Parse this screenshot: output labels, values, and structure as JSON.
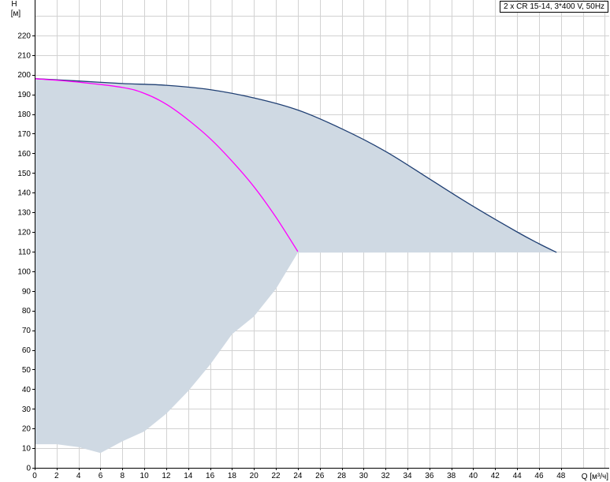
{
  "chart_data": {
    "type": "line",
    "title": "",
    "legend": "2 x CR 15-14, 3*400 V, 50Hz",
    "legend_placement": "top-right",
    "xlabel": "Q [м³/ч]",
    "ylabel": "H",
    "ylabel_unit": "[м]",
    "xlim": [
      0,
      52.4
    ],
    "ylim": [
      0,
      238
    ],
    "grid": true,
    "x_ticks": [
      0,
      2,
      4,
      6,
      8,
      10,
      12,
      14,
      16,
      18,
      20,
      22,
      24,
      26,
      28,
      30,
      32,
      34,
      36,
      38,
      40,
      42,
      44,
      46,
      48
    ],
    "y_ticks": [
      0,
      10,
      20,
      30,
      40,
      50,
      60,
      70,
      80,
      90,
      100,
      110,
      120,
      130,
      140,
      150,
      160,
      170,
      180,
      190,
      200,
      210,
      220
    ],
    "series": [
      {
        "id": "two-pumps",
        "color": "#1f3f73",
        "points": [
          [
            0,
            198
          ],
          [
            4,
            196.8
          ],
          [
            8,
            195.5
          ],
          [
            12,
            194.6
          ],
          [
            16,
            192.4
          ],
          [
            20,
            188.2
          ],
          [
            24,
            182
          ],
          [
            28,
            172.5
          ],
          [
            32,
            161
          ],
          [
            36,
            147
          ],
          [
            40,
            133
          ],
          [
            44,
            120
          ],
          [
            46,
            114
          ],
          [
            47.6,
            109.6
          ]
        ]
      },
      {
        "id": "one-pump",
        "color": "#ff00ff",
        "points": [
          [
            0,
            198
          ],
          [
            4,
            196.2
          ],
          [
            8,
            193.5
          ],
          [
            10,
            190.5
          ],
          [
            12,
            185
          ],
          [
            14,
            177
          ],
          [
            16,
            167.5
          ],
          [
            18,
            156
          ],
          [
            20,
            143
          ],
          [
            22,
            127.5
          ],
          [
            24,
            110
          ]
        ]
      }
    ],
    "areas": [
      {
        "id": "operating-range",
        "color": "#cfd9e3",
        "upper": [
          [
            0,
            198
          ],
          [
            4,
            196.8
          ],
          [
            8,
            195.5
          ],
          [
            12,
            194.6
          ],
          [
            16,
            192.4
          ],
          [
            20,
            188.2
          ],
          [
            24,
            182
          ],
          [
            28,
            172.5
          ],
          [
            32,
            161
          ],
          [
            36,
            147
          ],
          [
            40,
            133
          ],
          [
            44,
            120
          ],
          [
            46,
            114
          ],
          [
            47.6,
            109.6
          ]
        ],
        "lower": [
          [
            0,
            12
          ],
          [
            2,
            12
          ],
          [
            4,
            10.5
          ],
          [
            6,
            7.5
          ],
          [
            8,
            13.5
          ],
          [
            10,
            18.5
          ],
          [
            12,
            27.5
          ],
          [
            14,
            39
          ],
          [
            16,
            52.5
          ],
          [
            18,
            68
          ],
          [
            20,
            77
          ],
          [
            22,
            91
          ],
          [
            24,
            109.5
          ],
          [
            47.6,
            109.6
          ]
        ]
      }
    ]
  }
}
